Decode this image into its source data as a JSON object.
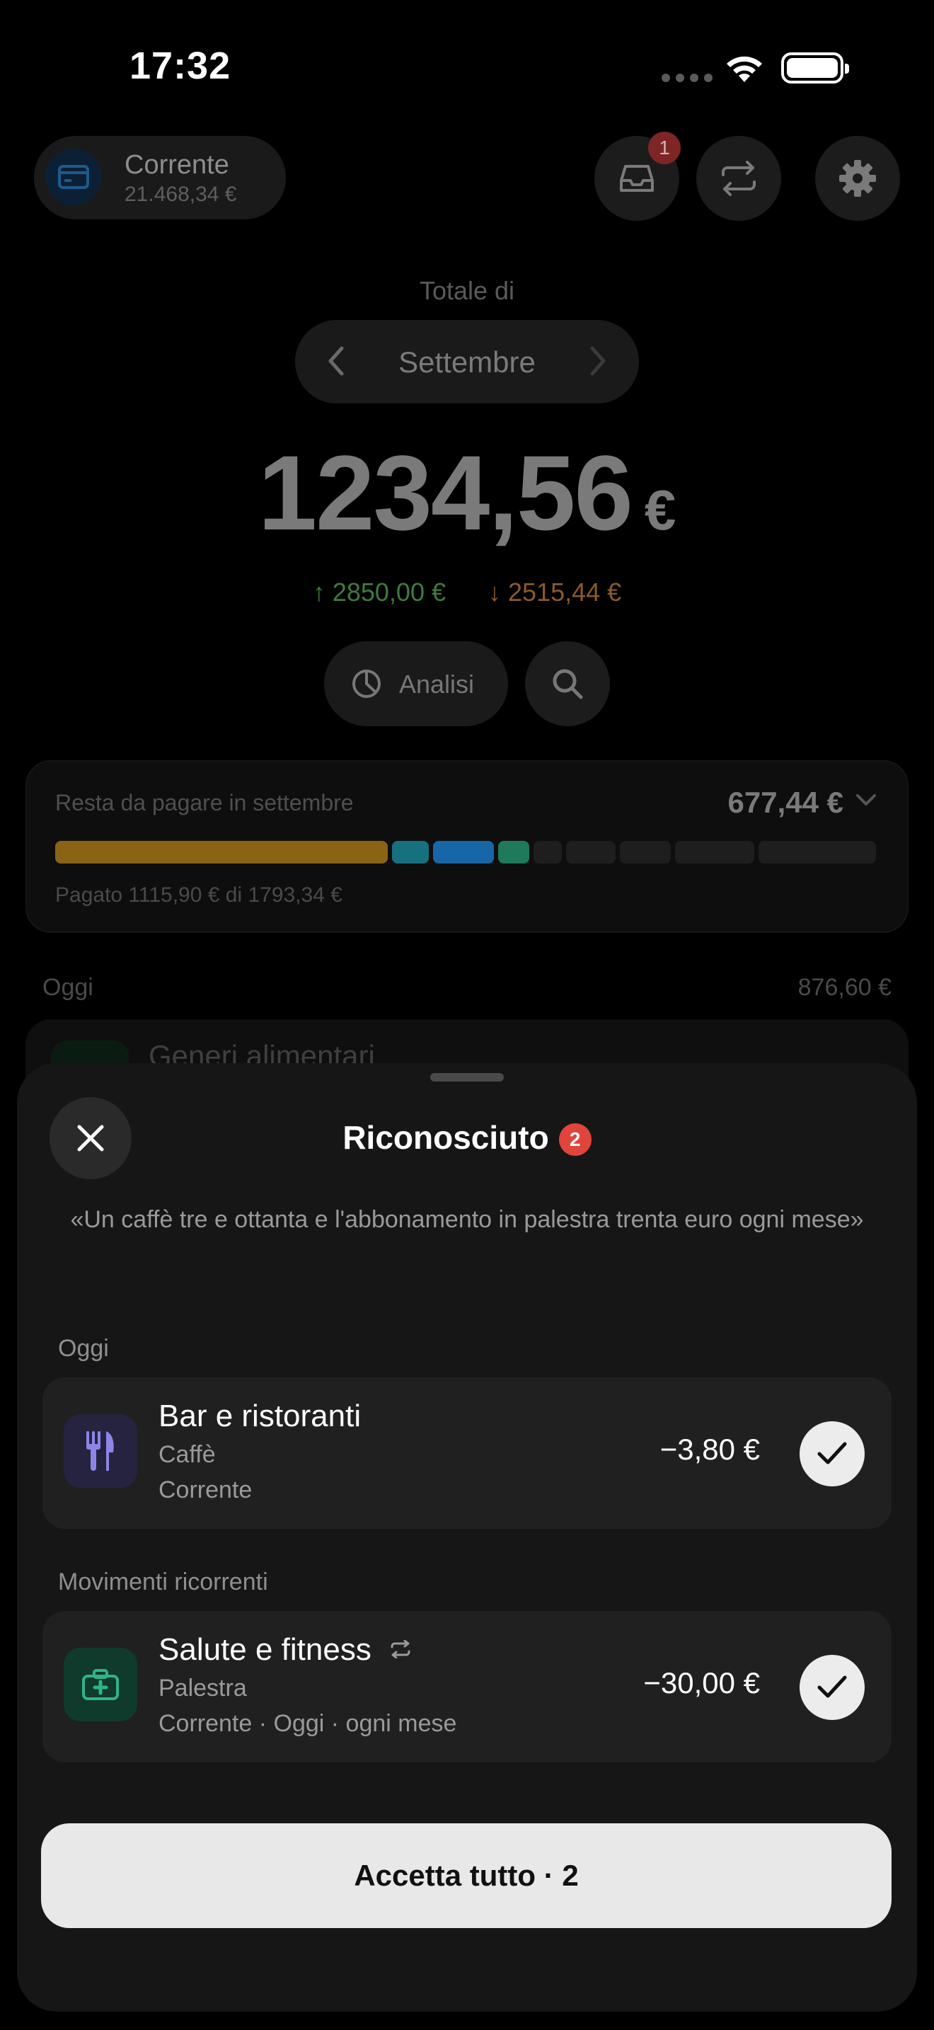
{
  "status_bar": {
    "time": "17:32"
  },
  "account": {
    "name": "Corrente",
    "balance": "21.468,34 €"
  },
  "inbox_badge": "1",
  "summary": {
    "caption": "Totale di",
    "month": "Settembre",
    "total_amount": "1234,56",
    "currency": "€",
    "income": "2850,00 €",
    "expense": "2515,44 €",
    "analysis_label": "Analisi"
  },
  "budget": {
    "title": "Resta da pagare in settembre",
    "remaining": "677,44 €",
    "paid_text": "Pagato 1115,90 € di 1793,34 €",
    "paid_amount": 1115.9,
    "total_amount": 1793.34,
    "segment_colors": [
      "#8a6414",
      "#17707e",
      "#1767a8",
      "#1e7a5a",
      "#1e1e1e"
    ]
  },
  "list": {
    "day_label": "Oggi",
    "day_total": "876,60 €",
    "partial_item": "Generi alimentari"
  },
  "sheet": {
    "title": "Riconosciuto",
    "count_badge": "2",
    "quote": "«Un caffè tre e ottanta e l'abbonamento in palestra trenta euro ogni mese»",
    "section_today": "Oggi",
    "section_recurring": "Movimenti ricorrenti",
    "items": [
      {
        "category": "Bar e ristoranti",
        "note": "Caffè",
        "meta": "Corrente",
        "amount": "−3,80 €",
        "icon": "fork-knife-icon",
        "icon_bg": "#25233f",
        "icon_color": "#8d85e6"
      },
      {
        "category": "Salute e fitness",
        "note": "Palestra",
        "meta": "Corrente · Oggi · ogni mese",
        "amount": "−30,00 €",
        "icon": "first-aid-kit-icon",
        "icon_bg": "#0f3a2c",
        "icon_color": "#2fb487"
      }
    ],
    "accept_label": "Accetta tutto · 2"
  }
}
